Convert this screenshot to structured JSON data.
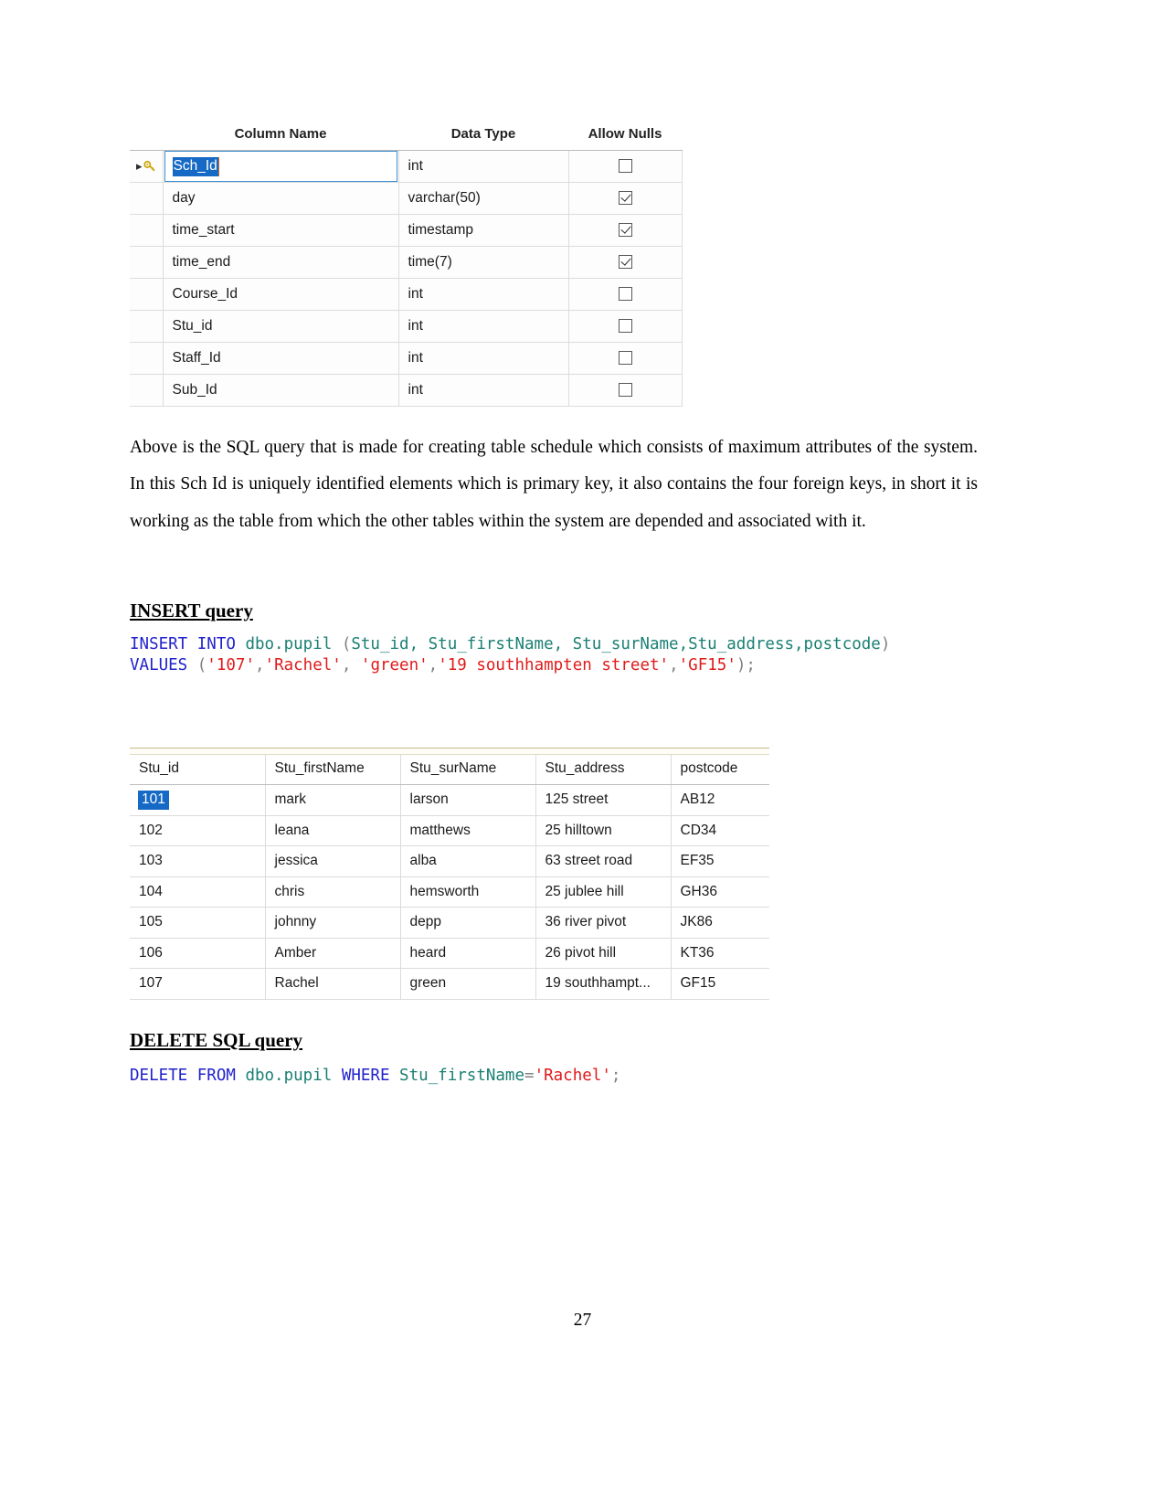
{
  "designer": {
    "headers": [
      "Column Name",
      "Data Type",
      "Allow Nulls"
    ],
    "rows": [
      {
        "name": "Sch_Id",
        "type": "int",
        "allow_nulls": false,
        "primary_key": true,
        "selected": true
      },
      {
        "name": "day",
        "type": "varchar(50)",
        "allow_nulls": true,
        "primary_key": false,
        "selected": false
      },
      {
        "name": "time_start",
        "type": "timestamp",
        "allow_nulls": true,
        "primary_key": false,
        "selected": false
      },
      {
        "name": "time_end",
        "type": "time(7)",
        "allow_nulls": true,
        "primary_key": false,
        "selected": false
      },
      {
        "name": "Course_Id",
        "type": "int",
        "allow_nulls": false,
        "primary_key": false,
        "selected": false
      },
      {
        "name": "Stu_id",
        "type": "int",
        "allow_nulls": false,
        "primary_key": false,
        "selected": false
      },
      {
        "name": "Staff_Id",
        "type": "int",
        "allow_nulls": false,
        "primary_key": false,
        "selected": false
      },
      {
        "name": "Sub_Id",
        "type": "int",
        "allow_nulls": false,
        "primary_key": false,
        "selected": false
      }
    ]
  },
  "paragraph": {
    "text": "Above is the SQL query that is made for creating table schedule which consists of maximum attributes of the system. In this Sch Id is uniquely identified elements which is primary key, it also contains the four foreign keys, in short it is working as the table from which the other tables within the system are depended and associated with it."
  },
  "insert_section": {
    "heading": "INSERT query",
    "line1": {
      "kw1": "INSERT INTO",
      "table": " dbo.pupil ",
      "paren_open": "(",
      "columns": "Stu_id, Stu_firstName, Stu_surName,Stu_address,postcode",
      "paren_close": ")"
    },
    "line2": {
      "kw": "VALUES",
      "paren_open": " (",
      "v1": "'107'",
      "sep1": ",",
      "v2": "'Rachel'",
      "sep2": ", ",
      "v3": "'green'",
      "sep3": ",",
      "v4": "'19 southhampten street'",
      "sep4": ",",
      "v5": "'GF15'",
      "tail": ");"
    }
  },
  "results": {
    "headers": [
      "Stu_id",
      "Stu_firstName",
      "Stu_surName",
      "Stu_address",
      "postcode"
    ],
    "rows": [
      {
        "stu_id": "101",
        "first": "mark",
        "sur": "larson",
        "address": "125 street",
        "postcode": "AB12",
        "selected": true
      },
      {
        "stu_id": "102",
        "first": "leana",
        "sur": "matthews",
        "address": "25 hilltown",
        "postcode": "CD34",
        "selected": false
      },
      {
        "stu_id": "103",
        "first": "jessica",
        "sur": "alba",
        "address": "63 street road",
        "postcode": "EF35",
        "selected": false
      },
      {
        "stu_id": "104",
        "first": "chris",
        "sur": "hemsworth",
        "address": "25 jublee hill",
        "postcode": "GH36",
        "selected": false
      },
      {
        "stu_id": "105",
        "first": "johnny",
        "sur": "depp",
        "address": "36 river pivot",
        "postcode": "JK86",
        "selected": false
      },
      {
        "stu_id": "106",
        "first": "Amber",
        "sur": "heard",
        "address": "26 pivot hill",
        "postcode": "KT36",
        "selected": false
      },
      {
        "stu_id": "107",
        "first": "Rachel",
        "sur": "green",
        "address": "19 southhampt...",
        "postcode": "GF15",
        "selected": false
      }
    ]
  },
  "delete_section": {
    "heading": "DELETE SQL query",
    "line1": {
      "kw1": "DELETE FROM",
      "table": " dbo.pupil ",
      "kw2": "WHERE",
      "column": " Stu_firstName",
      "eq": "=",
      "value": "'Rachel'",
      "tail": ";"
    }
  },
  "page_number": "27",
  "colors": {
    "keyword": "#2222cc",
    "identifier": "#1b8074",
    "string": "#e01b1b",
    "selection": "#1669c4",
    "grid_line": "#dcdcdc"
  }
}
